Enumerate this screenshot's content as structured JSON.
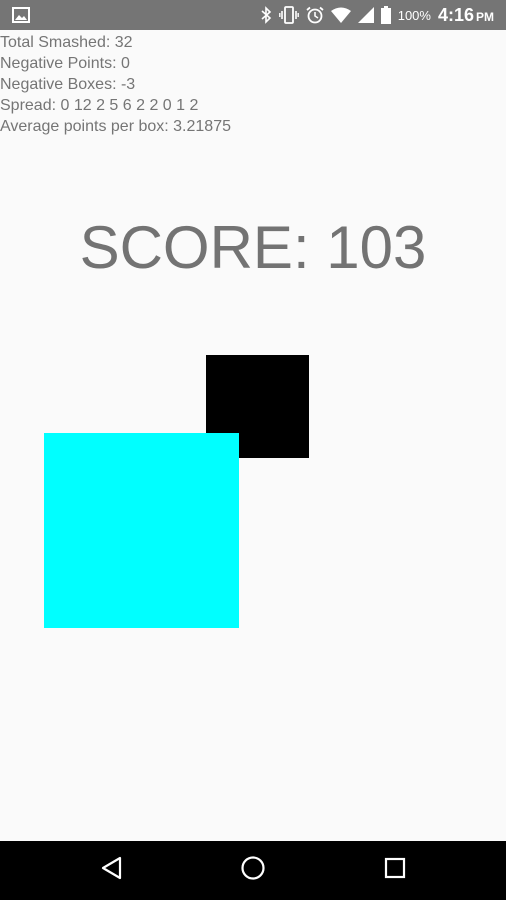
{
  "status_bar": {
    "battery_percent": "100%",
    "time": "4:16",
    "ampm": "PM",
    "icons": [
      "image-icon",
      "bluetooth-icon",
      "vibrate-icon",
      "alarm-icon",
      "wifi-icon",
      "signal-icon",
      "battery-icon"
    ]
  },
  "stats": {
    "total_smashed": "Total Smashed: 32",
    "negative_points": "Negative Points: 0",
    "negative_boxes": "Negative Boxes: -3",
    "spread": "Spread: 0 12 2 5 6 2 2 0 1 2",
    "average": "Average points per box: 3.21875"
  },
  "score": {
    "text": "SCORE: 103"
  },
  "game": {
    "boxes": [
      {
        "name": "black-box",
        "color": "#000000"
      },
      {
        "name": "cyan-box",
        "color": "#00ffff"
      }
    ]
  },
  "colors": {
    "status_bar": "#757575",
    "background": "#fafafa",
    "text": "#757575",
    "nav_bar": "#000000"
  },
  "nav_bar": {
    "icons": [
      "back-icon",
      "home-icon",
      "recents-icon"
    ]
  }
}
